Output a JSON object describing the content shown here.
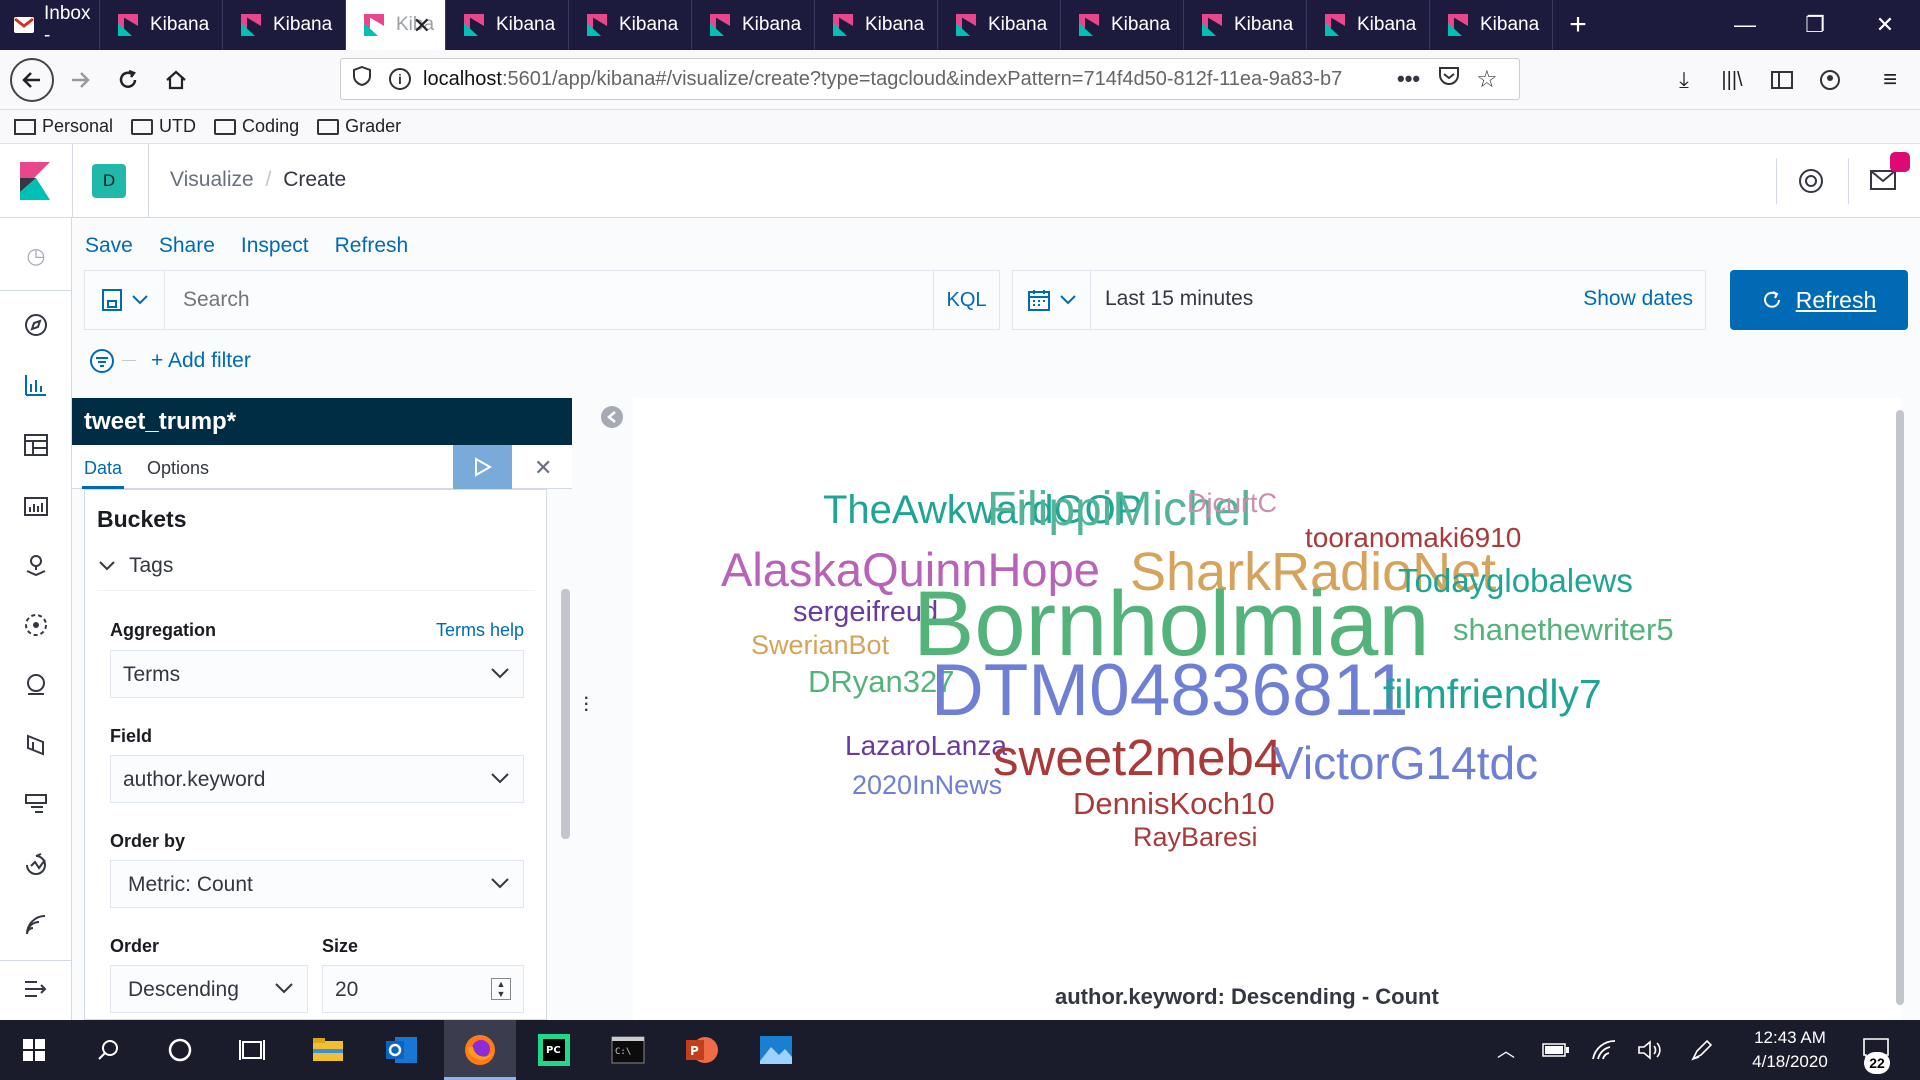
{
  "browser": {
    "tabs": [
      {
        "label": "Inbox -",
        "kind": "mail"
      },
      {
        "label": "Kibana",
        "kind": "kibana"
      },
      {
        "label": "Kibana",
        "kind": "kibana"
      },
      {
        "label": "Kiba",
        "kind": "kibana",
        "active": true
      },
      {
        "label": "Kibana",
        "kind": "kibana"
      },
      {
        "label": "Kibana",
        "kind": "kibana"
      },
      {
        "label": "Kibana",
        "kind": "kibana"
      },
      {
        "label": "Kibana",
        "kind": "kibana"
      },
      {
        "label": "Kibana",
        "kind": "kibana"
      },
      {
        "label": "Kibana",
        "kind": "kibana"
      },
      {
        "label": "Kibana",
        "kind": "kibana"
      },
      {
        "label": "Kibana",
        "kind": "kibana"
      },
      {
        "label": "Kibana",
        "kind": "kibana"
      }
    ],
    "url_host": "localhost",
    "url_rest": ":5601/app/kibana#/visualize/create?type=tagcloud&indexPattern=714f4d50-812f-11ea-9a83-b7",
    "bookmarks": [
      "Personal",
      "UTD",
      "Coding",
      "Grader"
    ]
  },
  "kibana": {
    "space_letter": "D",
    "breadcrumb_parent": "Visualize",
    "breadcrumb_current": "Create",
    "top_menu": [
      "Save",
      "Share",
      "Inspect",
      "Refresh"
    ],
    "search_placeholder": "Search",
    "kql_label": "KQL",
    "time_range": "Last 15 minutes",
    "show_dates": "Show dates",
    "refresh_button": "Refresh",
    "add_filter": "+ Add filter"
  },
  "editor": {
    "index_pattern": "tweet_trump*",
    "tab_data": "Data",
    "tab_options": "Options",
    "buckets_title": "Buckets",
    "bucket_name": "Tags",
    "aggregation_label": "Aggregation",
    "terms_help": "Terms help",
    "aggregation_value": "Terms",
    "field_label": "Field",
    "field_value": "author.keyword",
    "order_by_label": "Order by",
    "order_by_value": "Metric: Count",
    "order_label": "Order",
    "order_value": "Descending",
    "size_label": "Size",
    "size_value": "20"
  },
  "tagcloud": {
    "words": [
      {
        "text": "TheAwkwardGOP",
        "color": "#1ea593"
      },
      {
        "text": "FilippiMichel",
        "color": "#54b399"
      },
      {
        "text": "DjcurtC",
        "color": "#ca8eae"
      },
      {
        "text": "AlaskaQuinnHope",
        "color": "#b962b9"
      },
      {
        "text": "SharkRadioNet",
        "color": "#d6a35c"
      },
      {
        "text": "tooranomaki6910",
        "color": "#a83a3a"
      },
      {
        "text": "Todayglobalews",
        "color": "#1ea593"
      },
      {
        "text": "sergeifreud",
        "color": "#6a3b9e"
      },
      {
        "text": "Bornholmian",
        "color": "#54b37b"
      },
      {
        "text": "shanethewriter5",
        "color": "#54b37b"
      },
      {
        "text": "SwerianBot",
        "color": "#d6a35c"
      },
      {
        "text": "DRyan327",
        "color": "#54b37b"
      },
      {
        "text": "DTM04836811",
        "color": "#6f80d4"
      },
      {
        "text": "filmfriendly7",
        "color": "#1ea593"
      },
      {
        "text": "LazaroLanza",
        "color": "#6a3b9e"
      },
      {
        "text": "sweet2meb4",
        "color": "#a83a3a"
      },
      {
        "text": "VictorG14tdc",
        "color": "#6f80d4"
      },
      {
        "text": "2020InNews",
        "color": "#6f80d4"
      },
      {
        "text": "DennisKoch10",
        "color": "#a83a3a"
      },
      {
        "text": "RayBaresi",
        "color": "#a83a3a"
      }
    ],
    "caption": "author.keyword: Descending - Count"
  },
  "taskbar": {
    "time": "12:43 AM",
    "date": "4/18/2020",
    "notification_count": "22"
  }
}
